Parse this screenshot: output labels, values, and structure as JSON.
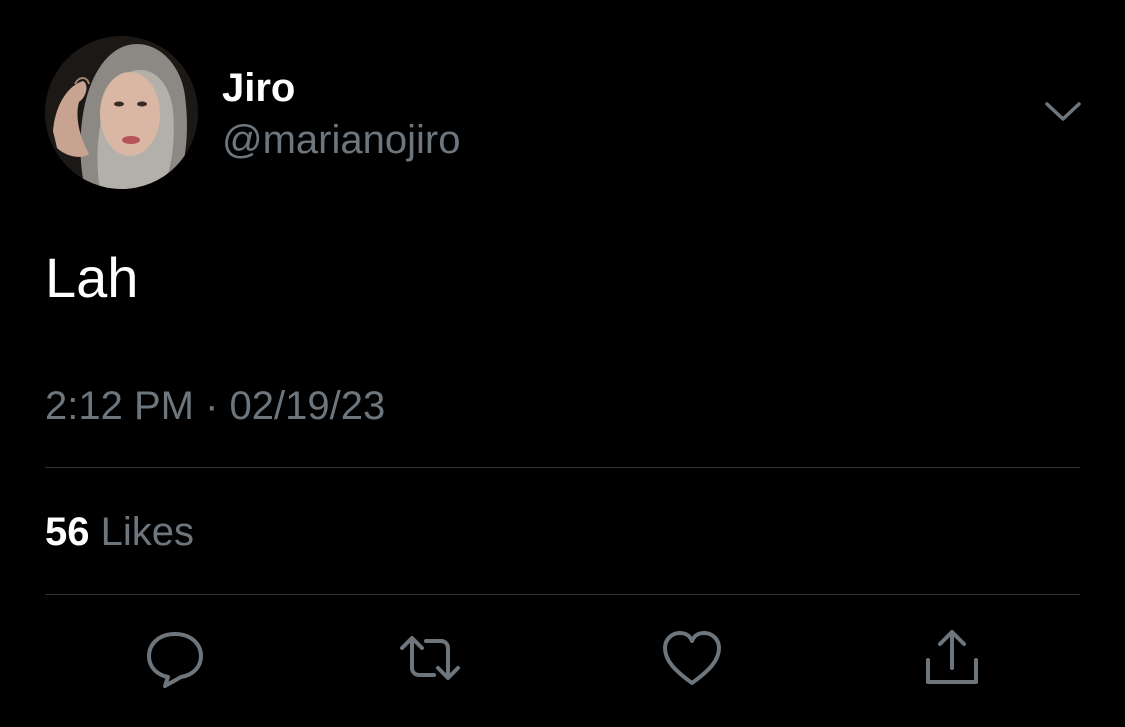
{
  "tweet": {
    "author": {
      "display_name": "Jiro",
      "handle": "@marianojiro",
      "avatar_icon": "profile-photo"
    },
    "text": "Lah",
    "timestamp": "2:12 PM · 02/19/23",
    "stats": {
      "likes_count": "56",
      "likes_label": "Likes"
    },
    "actions": [
      {
        "icon": "reply-icon"
      },
      {
        "icon": "retweet-icon"
      },
      {
        "icon": "heart-icon"
      },
      {
        "icon": "share-icon"
      }
    ]
  },
  "colors": {
    "background": "#000000",
    "primary_text": "#ffffff",
    "secondary_text": "#6e767d",
    "divider": "#2f3336",
    "icon": "#6e767d"
  }
}
